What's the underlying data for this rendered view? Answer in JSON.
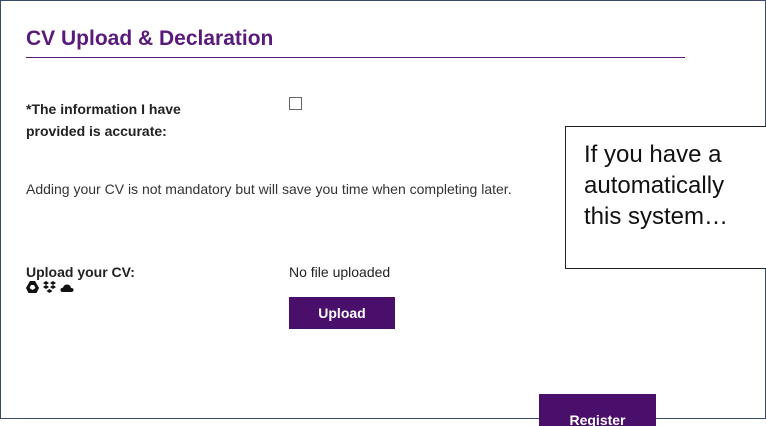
{
  "section": {
    "title": "CV Upload & Declaration"
  },
  "declaration": {
    "label_line1": "*The information I have",
    "label_line2": "provided is accurate:",
    "checked": false
  },
  "info": {
    "text": "Adding your CV is not mandatory but will save you time when completing later."
  },
  "cv_upload": {
    "label": "Upload your CV:",
    "icons": [
      "google-drive-icon",
      "dropbox-icon",
      "onedrive-icon"
    ],
    "status": "No file uploaded",
    "button_label": "Upload"
  },
  "register": {
    "button_label": "Register"
  },
  "tooltip": {
    "line1": "If you have a",
    "line2": "automatically",
    "line3": "this system…"
  },
  "colors": {
    "accent": "#5a1a7a",
    "button": "#4a0e6b"
  }
}
